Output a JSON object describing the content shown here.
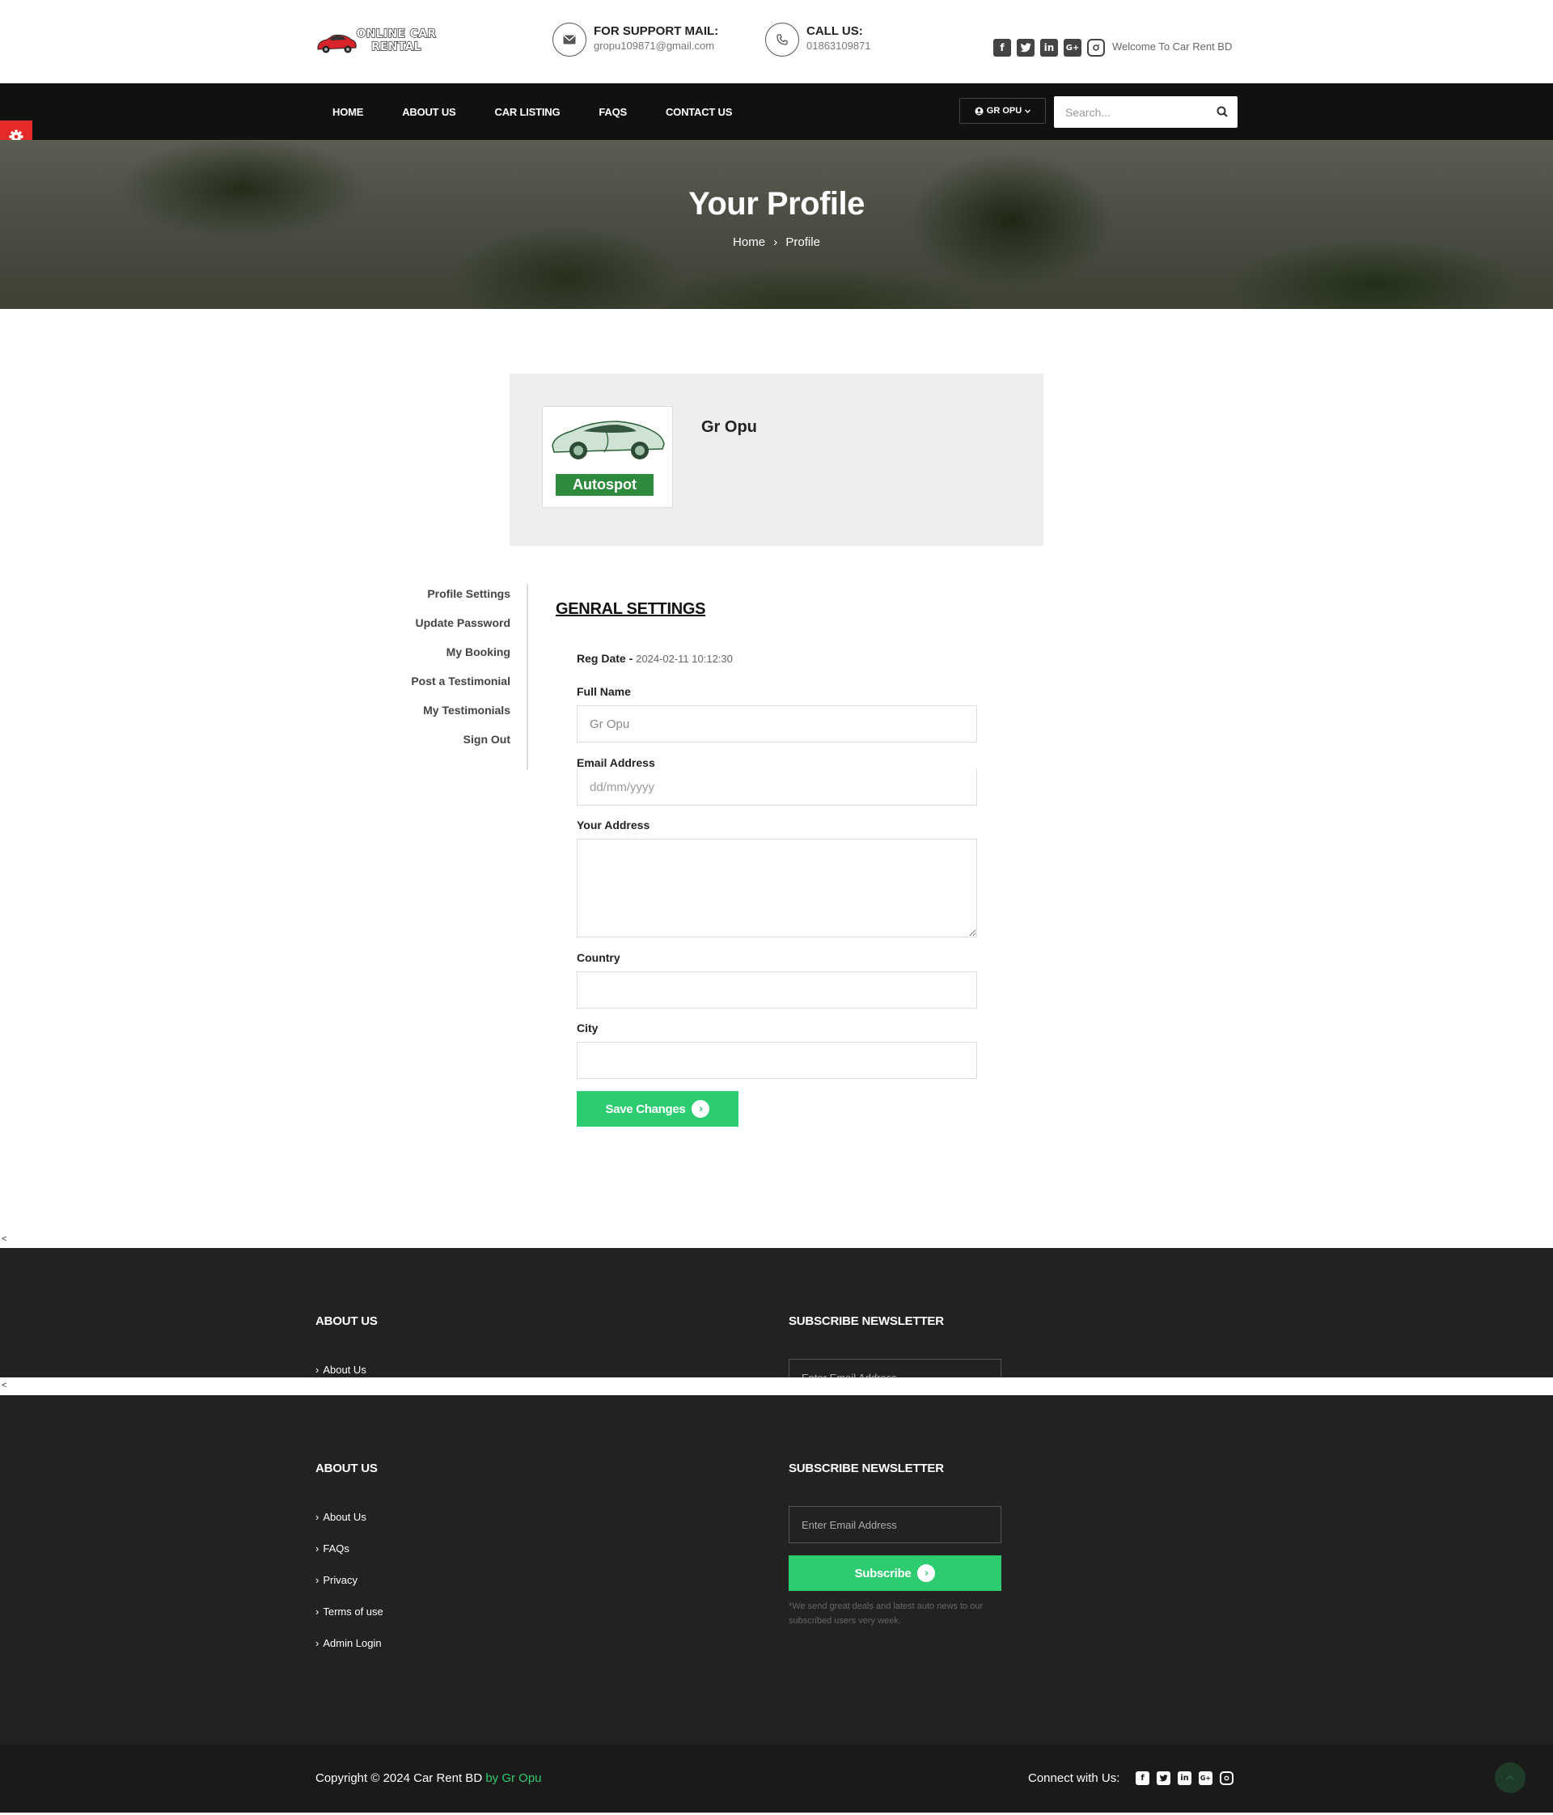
{
  "header": {
    "logo_text": "ONLINE CAR RENTAL",
    "support": {
      "title": "FOR SUPPORT MAIL:",
      "value": "gropu109871@gmail.com"
    },
    "call": {
      "title": "CALL US:",
      "value": "01863109871"
    },
    "social_icons": [
      "facebook-icon",
      "twitter-icon",
      "linkedin-icon",
      "google-plus-icon",
      "instagram-icon"
    ],
    "welcome": "Welcome To Car Rent BD"
  },
  "nav": {
    "links": [
      "HOME",
      "ABOUT US",
      "CAR LISTING",
      "FAQS",
      "CONTACT US"
    ],
    "user_label": "GR OPU",
    "search_placeholder": "Search..."
  },
  "hero": {
    "title": "Your Profile",
    "breadcrumb": [
      "Home",
      "Profile"
    ]
  },
  "profile": {
    "avatar_label": "Autospot",
    "name": "Gr Opu"
  },
  "sidebar": {
    "items": [
      "Profile Settings",
      "Update Password",
      "My Booking",
      "Post a Testimonial",
      "My Testimonials",
      "Sign Out"
    ]
  },
  "form": {
    "heading": "GENRAL SETTINGS",
    "reg_date_label": "Reg Date - ",
    "reg_date_value": "2024-02-11 10:12:30",
    "full_name_label": "Full Name",
    "full_name_value": "Gr Opu",
    "email_label": "Email Address",
    "email_placeholder": "dd/mm/yyyy",
    "address_label": "Your Address",
    "country_label": "Country",
    "city_label": "City",
    "save_label": "Save Changes"
  },
  "footer": {
    "stray_mark": "<",
    "about_heading": "ABOUT US",
    "links": [
      "About Us",
      "FAQs",
      "Privacy",
      "Terms of use",
      "Admin Login"
    ],
    "newsletter_heading": "SUBSCRIBE NEWSLETTER",
    "newsletter_placeholder": "Enter Email Address",
    "subscribe_label": "Subscribe",
    "newsletter_note": "*We send great deals and latest auto news to our subscribed users very week.",
    "copyright": "Copyright © 2024 Car Rent BD",
    "copyright_author": "by Gr Opu",
    "connect_label": "Connect with Us:"
  },
  "colors": {
    "accent_green": "#2ecc71",
    "nav_bg": "#111111",
    "footer_bg": "#222222",
    "settings_tab": "#e52a2a"
  }
}
